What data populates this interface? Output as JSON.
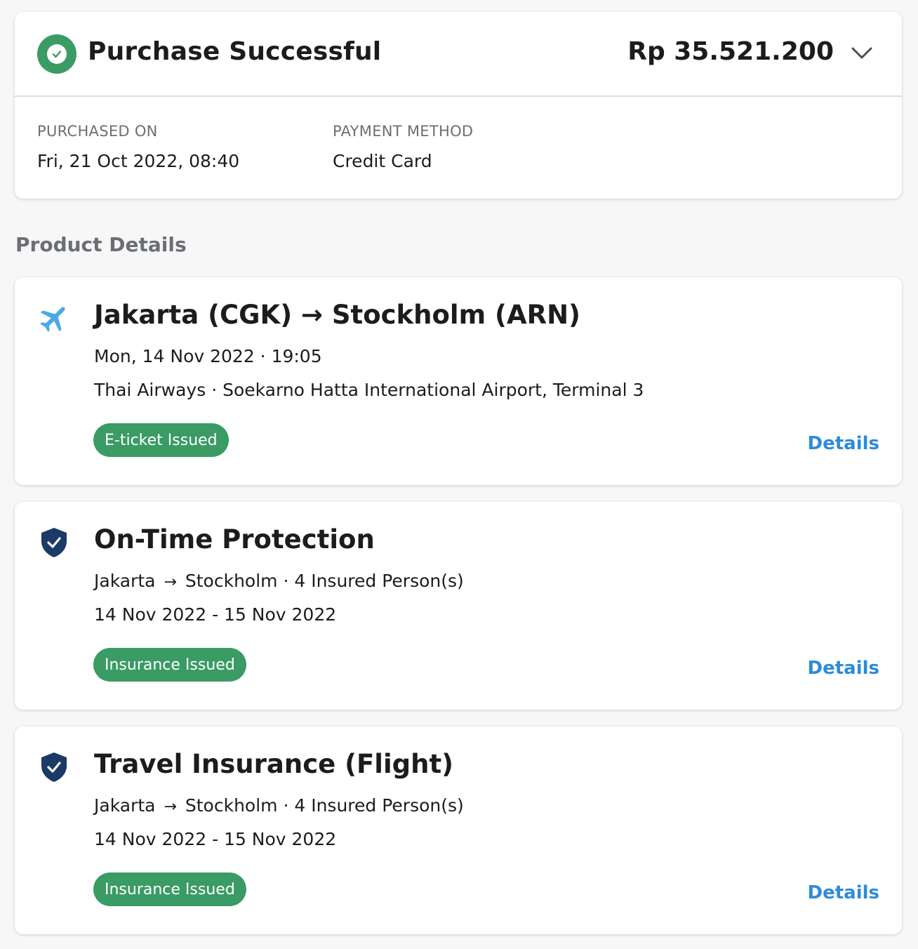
{
  "summary": {
    "status_title": "Purchase Successful",
    "total": "Rp 35.521.200",
    "purchased_on_label": "PURCHASED ON",
    "purchased_on_value": "Fri, 21 Oct 2022, 08:40",
    "payment_method_label": "PAYMENT METHOD",
    "payment_method_value": "Credit Card"
  },
  "section_title": "Product Details",
  "products": [
    {
      "icon": "airplane-icon",
      "title": "Jakarta (CGK) → Stockholm (ARN)",
      "line1": "Mon, 14 Nov 2022 · 19:05",
      "line2": "Thai Airways · Soekarno Hatta International Airport, Terminal 3",
      "badge": "E-ticket Issued",
      "details_label": "Details"
    },
    {
      "icon": "shield-check-icon",
      "title": "On-Time Protection",
      "origin": "Jakarta",
      "destination_line": "Stockholm · 4 Insured Person(s)",
      "line2": "14 Nov 2022 - 15 Nov 2022",
      "badge": "Insurance Issued",
      "details_label": "Details"
    },
    {
      "icon": "shield-check-icon",
      "title": "Travel Insurance (Flight)",
      "origin": "Jakarta",
      "destination_line": "Stockholm · 4 Insured Person(s)",
      "line2": "14 Nov 2022 - 15 Nov 2022",
      "badge": "Insurance Issued",
      "details_label": "Details"
    }
  ],
  "colors": {
    "success_green": "#3a9b65",
    "link_blue": "#2e8bd8",
    "plane_blue": "#4aa8e6",
    "shield_navy": "#1b3a66",
    "muted_text": "#6b6f74"
  }
}
